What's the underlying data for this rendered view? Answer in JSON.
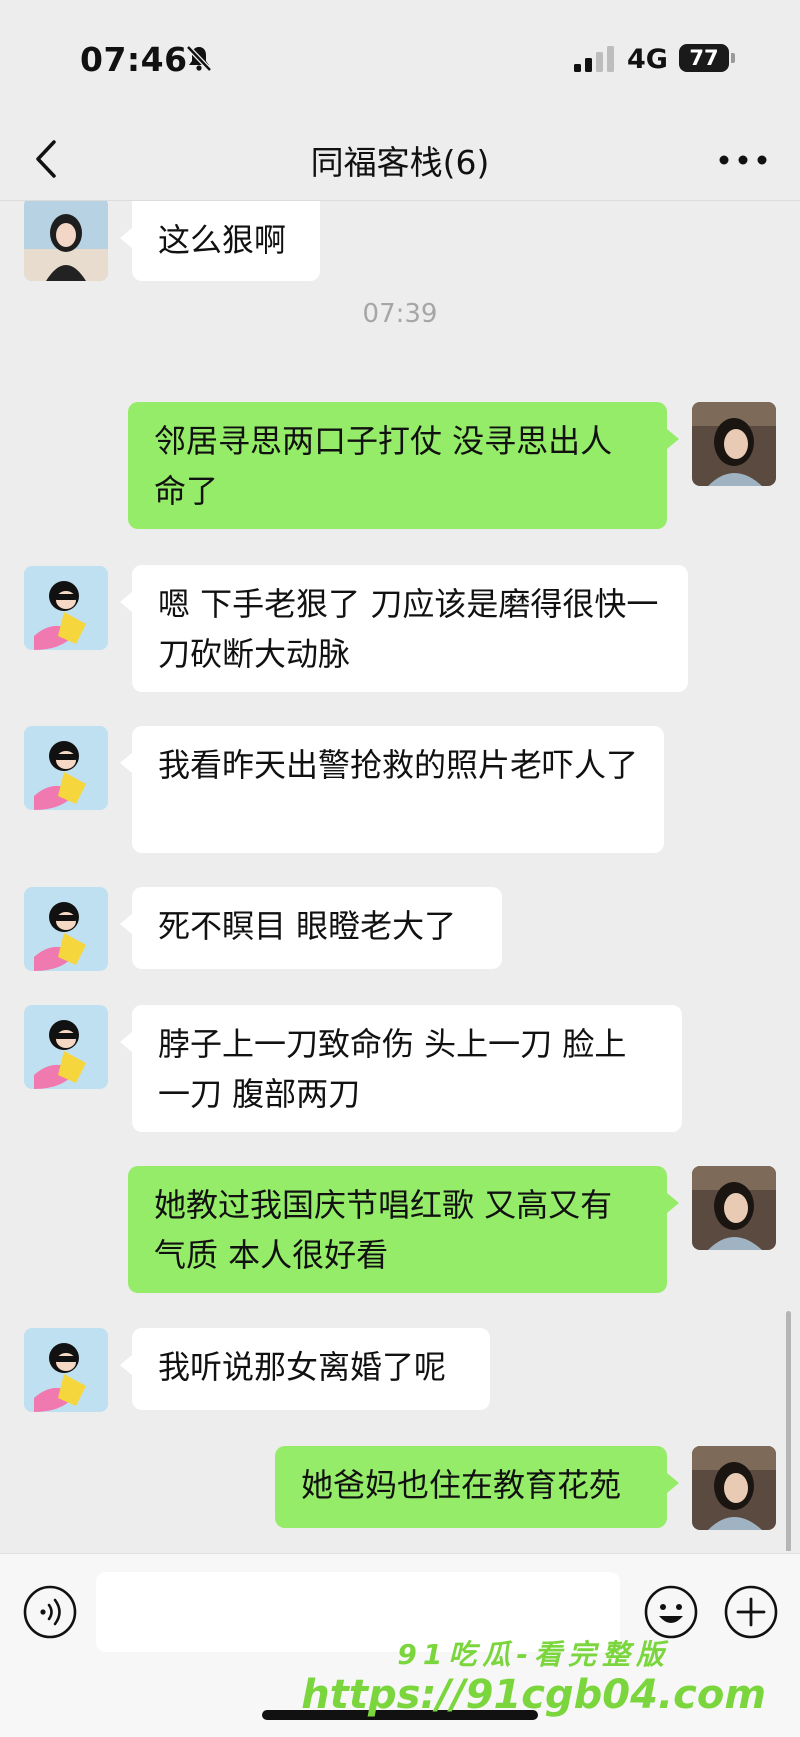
{
  "status_bar": {
    "time": "07:46",
    "network": "4G",
    "battery": "77"
  },
  "nav": {
    "title": "同福客栈(6)"
  },
  "chat": {
    "timestamp": "07:39",
    "messages": [
      {
        "side": "in",
        "text": "这么狠啊"
      },
      {
        "side": "out",
        "text": "邻居寻思两口子打仗 没寻思出人命了"
      },
      {
        "side": "in",
        "text": "嗯 下手老狠了 刀应该是磨得很快一刀砍断大动脉"
      },
      {
        "side": "in",
        "text": "我看昨天出警抢救的照片老吓人了"
      },
      {
        "side": "in",
        "text": "死不瞑目 眼瞪老大了"
      },
      {
        "side": "in",
        "text": "脖子上一刀致命伤 头上一刀 脸上一刀 腹部两刀"
      },
      {
        "side": "out",
        "text": "她教过我国庆节唱红歌 又高又有气质 本人很好看"
      },
      {
        "side": "in",
        "text": "我听说那女离婚了呢"
      },
      {
        "side": "out",
        "text": "她爸妈也住在教育花苑"
      }
    ]
  },
  "input_bar": {
    "value": "",
    "icons": [
      "voice-icon",
      "emoji-icon",
      "plus-icon"
    ]
  },
  "watermark": {
    "line1": "91吃瓜-看完整版",
    "line2": "https://91cgb04.com"
  },
  "colors": {
    "background": "#ededed",
    "bubble_out": "#95ec69",
    "bubble_in": "#ffffff",
    "watermark": "#7bd63e"
  }
}
